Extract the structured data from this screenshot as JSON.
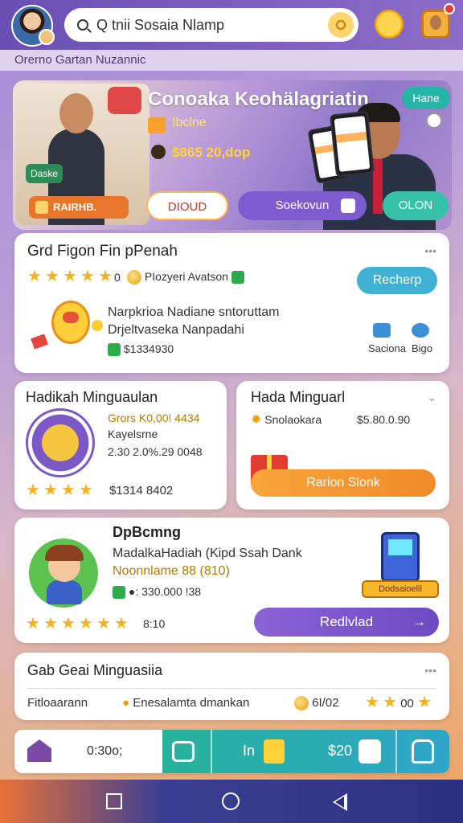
{
  "header": {
    "search_text": "Q tnii  Sosaia Nlamp",
    "icons": [
      "avatar",
      "search-icon",
      "hand-icon",
      "portrait-icon"
    ]
  },
  "subheader": {
    "text": "Orerno Gartan Nuzannic"
  },
  "hero": {
    "title": "Conoaka Keohälagriatin",
    "subtitle": "Ibclne",
    "price": "$865 20,dop",
    "chip": "Hane",
    "tag1": "Daske",
    "tag2": "RAIRHB.",
    "btn1": "DIOUD",
    "btn2": "Soekovun",
    "btn3": "OLON"
  },
  "card1": {
    "title": "Grd Figon Fin pPenah",
    "rating_value": "0",
    "meta": "PIozyeri Avatson",
    "action": "Recherp",
    "line1": "Narpkrioa Nadiane sntoruttam",
    "line2": "Drjeltvaseka Nanpadahi",
    "amount": "$1334930",
    "side1": "Saciona",
    "side2": "Bigo"
  },
  "card2": {
    "title": "Hadikah Minguaulan",
    "line1": "Grors K0,00! 4434",
    "line2": "Kayelsrne",
    "line3": "2.30 2.0%.29 0048",
    "price": "$1314 8402"
  },
  "card3": {
    "title": "Hada Minguarl",
    "label": "Snolaokara",
    "price": "$5.80.0.90",
    "button": "Rarion Slonk"
  },
  "card4": {
    "title": "DpBcmng",
    "line1": "MadalkaHadiah (Kipd Ssah Dank",
    "line2": "Noonnlame 88 (810)",
    "line3": "●: 330.000 !38",
    "rating_label": "8:10",
    "banner": "Dodsaioelil",
    "button": "Redlvlad"
  },
  "card5": {
    "title": "Gab Geai Minguasiia",
    "left_text": "Fitloaarann",
    "mid_text": "Enesalamta dmankan",
    "value": "6I/02",
    "end_value": "00"
  },
  "navbar": {
    "left_label": "0:30o;",
    "mid_label": "In",
    "right_label": "$20"
  }
}
